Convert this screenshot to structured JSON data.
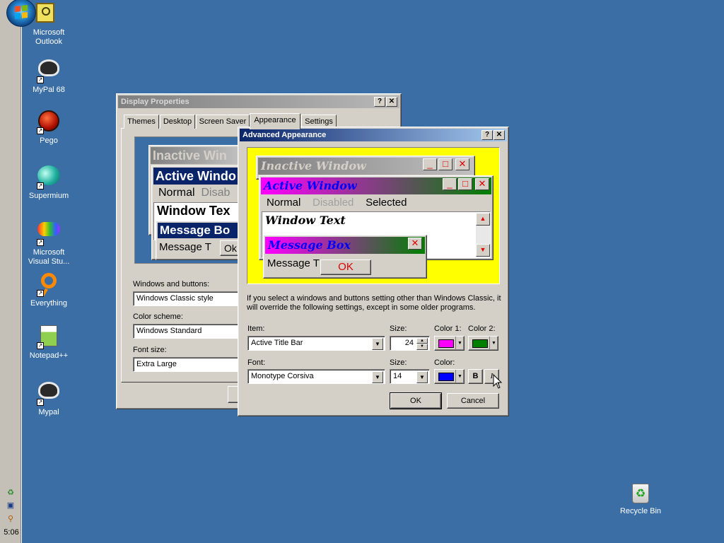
{
  "desktop": {
    "icons": [
      {
        "label": "Microsoft Outlook",
        "icon": "outlook-icon"
      },
      {
        "label": "MyPal 68",
        "icon": "mypal-icon"
      },
      {
        "label": "Pego",
        "icon": "pego-icon"
      },
      {
        "label": "Supermium",
        "icon": "supermium-icon"
      },
      {
        "label": "Microsoft Visual Stu...",
        "icon": "visual-studio-icon"
      },
      {
        "label": "Everything",
        "icon": "everything-icon"
      },
      {
        "label": "Notepad++",
        "icon": "notepadpp-icon"
      },
      {
        "label": "Mypal",
        "icon": "mypal-icon"
      }
    ],
    "recycle_bin": "Recycle Bin"
  },
  "taskbar": {
    "clock": "5:06"
  },
  "display_properties": {
    "title": "Display Properties",
    "help_btn": "?",
    "close_btn": "✕",
    "tabs": [
      "Themes",
      "Desktop",
      "Screen Saver",
      "Appearance",
      "Settings"
    ],
    "preview": {
      "inactive": "Inactive Win",
      "active": "Active Windo",
      "normal": "Normal",
      "disabled": "Disab",
      "window_text": "Window Tex",
      "message_box": "Message Bo",
      "message_text": "Message T",
      "ok": "Ok"
    },
    "labels": {
      "windows_buttons": "Windows and buttons:",
      "color_scheme": "Color scheme:",
      "font_size": "Font size:"
    },
    "values": {
      "windows_buttons": "Windows Classic style",
      "color_scheme": "Windows Standard",
      "font_size": "Extra Large"
    }
  },
  "advanced": {
    "title": "Advanced Appearance",
    "help_btn": "?",
    "close_btn": "✕",
    "preview": {
      "inactive": "Inactive Window",
      "active": "Active Window",
      "normal": "Normal",
      "disabled": "Disabled",
      "selected": "Selected",
      "window_text": "Window Text",
      "message_box": "Message Box",
      "message_text": "Message T",
      "ok": "OK"
    },
    "info": "If you select a windows and buttons setting other than Windows Classic, it will override the following settings, except in some older programs.",
    "item_label": "Item:",
    "item_value": "Active Title Bar",
    "size_label": "Size:",
    "size_value": "24",
    "color1_label": "Color 1:",
    "color2_label": "Color 2:",
    "font_label": "Font:",
    "font_value": "Monotype Corsiva",
    "font_size_label": "Size:",
    "font_size_value": "14",
    "font_color_label": "Color:",
    "bold": "B",
    "italic": "I",
    "ok": "OK",
    "cancel": "Cancel",
    "colors": {
      "color1": "#ff00ff",
      "color2": "#008000",
      "font_color": "#0000ff",
      "preview_bg": "#ffff00"
    }
  }
}
